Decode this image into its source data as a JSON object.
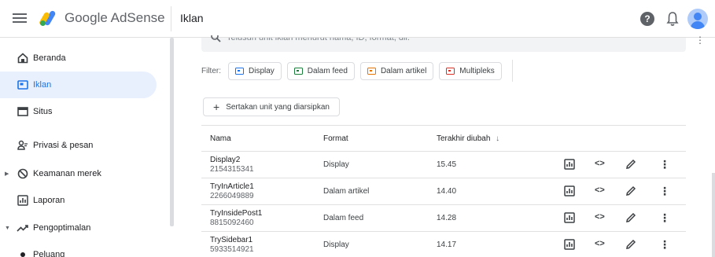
{
  "header": {
    "brand_google": "Google",
    "brand_product": "AdSense",
    "page_title": "Iklan",
    "help_glyph": "?"
  },
  "sidebar": {
    "items": [
      {
        "label": "Beranda",
        "icon": "home-icon"
      },
      {
        "label": "Iklan",
        "icon": "ads-icon",
        "active": true
      },
      {
        "label": "Situs",
        "icon": "sites-icon"
      },
      {
        "label": "Privasi & pesan",
        "icon": "privacy-icon"
      },
      {
        "label": "Keamanan merek",
        "icon": "brand-safety-icon",
        "expandable": true
      },
      {
        "label": "Laporan",
        "icon": "reports-icon"
      },
      {
        "label": "Pengoptimalan",
        "icon": "optimization-icon",
        "expandable": true,
        "expanded": true
      },
      {
        "label": "Peluang",
        "icon": "dot-icon"
      }
    ]
  },
  "search": {
    "placeholder": "Telusuri unit iklan menurut nama, ID, format, dll."
  },
  "filter": {
    "label": "Filter:",
    "chips": [
      {
        "label": "Display",
        "color": "#1a73e8"
      },
      {
        "label": "Dalam feed",
        "color": "#188038"
      },
      {
        "label": "Dalam artikel",
        "color": "#e37400"
      },
      {
        "label": "Multipleks",
        "color": "#d93025"
      }
    ]
  },
  "add_button": {
    "label": "Sertakan unit yang diarsipkan"
  },
  "table": {
    "headers": {
      "name": "Nama",
      "format": "Format",
      "modified": "Terakhir diubah"
    },
    "rows": [
      {
        "name": "Display2",
        "id": "2154315341",
        "format": "Display",
        "modified": "15.45"
      },
      {
        "name": "TryInArticle1",
        "id": "2266049889",
        "format": "Dalam artikel",
        "modified": "14.40"
      },
      {
        "name": "TryInsidePost1",
        "id": "8815092460",
        "format": "Dalam feed",
        "modified": "14.28"
      },
      {
        "name": "TrySidebar1",
        "id": "5933514921",
        "format": "Display",
        "modified": "14.17"
      }
    ]
  },
  "colors": {
    "accent": "#1a73e8",
    "active_bg": "#e8f0fe"
  }
}
